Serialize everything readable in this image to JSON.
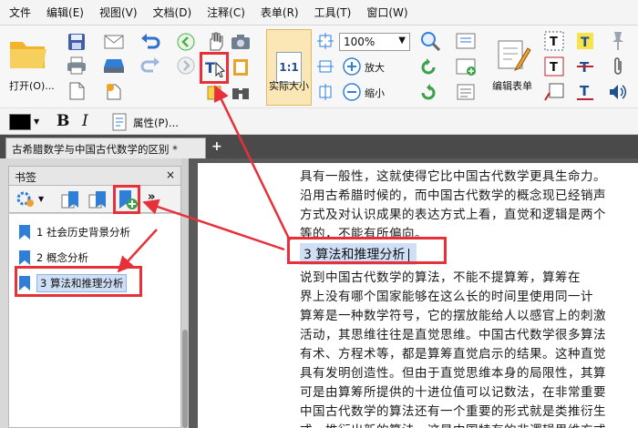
{
  "menubar": {
    "items": [
      "文件",
      "编辑(E)",
      "视图(V)",
      "文档(D)",
      "注释(C)",
      "表单(R)",
      "工具(T)",
      "窗口(W)"
    ]
  },
  "ribbon": {
    "open_label": "打开(O)...",
    "zoom_value": "100%",
    "actual_size_glyph": "1:1",
    "actual_size_label": "实际大小",
    "zoom_in_label": "放大",
    "zoom_out_label": "缩小",
    "edit_form_label": "编辑表单"
  },
  "format_toolbar": {
    "bold": "B",
    "italic": "I",
    "properties_label": "属性(P)..."
  },
  "tabs": {
    "doc_tab_label": "古希腊数学与中国古代数学的区别 *",
    "add_tab": "+"
  },
  "bookmarks": {
    "title": "书签",
    "close": "×",
    "items": [
      {
        "label": "1 社会历史背景分析"
      },
      {
        "label": "2 概念分析"
      },
      {
        "label": "3 算法和推理分析"
      }
    ]
  },
  "document": {
    "lines_top": [
      "具有一般性，这就使得它比中国古代数学更具生命力。",
      "沿用古希腊时候的，而中国古代数学的概念现已经销声",
      "方式及对认识成果的表达方式上看，直觉和逻辑是两个",
      "等的，不能有所偏向。"
    ],
    "heading": "3    算法和推理分析",
    "lines_bottom": [
      "    说到中国古代数学的算法，不能不提算筹，算筹在",
      "界上没有哪个国家能够在这么长的时间里使用同一计",
      "算筹是一种数学符号，它的摆放能给人以感官上的刺激",
      "活动，其思维往往是直觉思维。中国古代数学很多算法",
      "有术、方程术等，都是算筹直觉启示的结果。这种直觉",
      "具有发明创造性。但由于直觉思维本身的局限性，其算",
      "可是由算筹所提供的十进位值可以记数法，在非常重要",
      "中国古代数学的算法还有一个重要的形式就是类推衍生",
      "式，推衍出新的算法，这是中国特有的非逻辑思维方式"
    ]
  },
  "colors": {
    "annotation_red": "#e8303a",
    "bookmark_blue": "#2f7fd8",
    "selection_blue": "#cfe0f6",
    "tab_bar": "#4a4a4a"
  }
}
